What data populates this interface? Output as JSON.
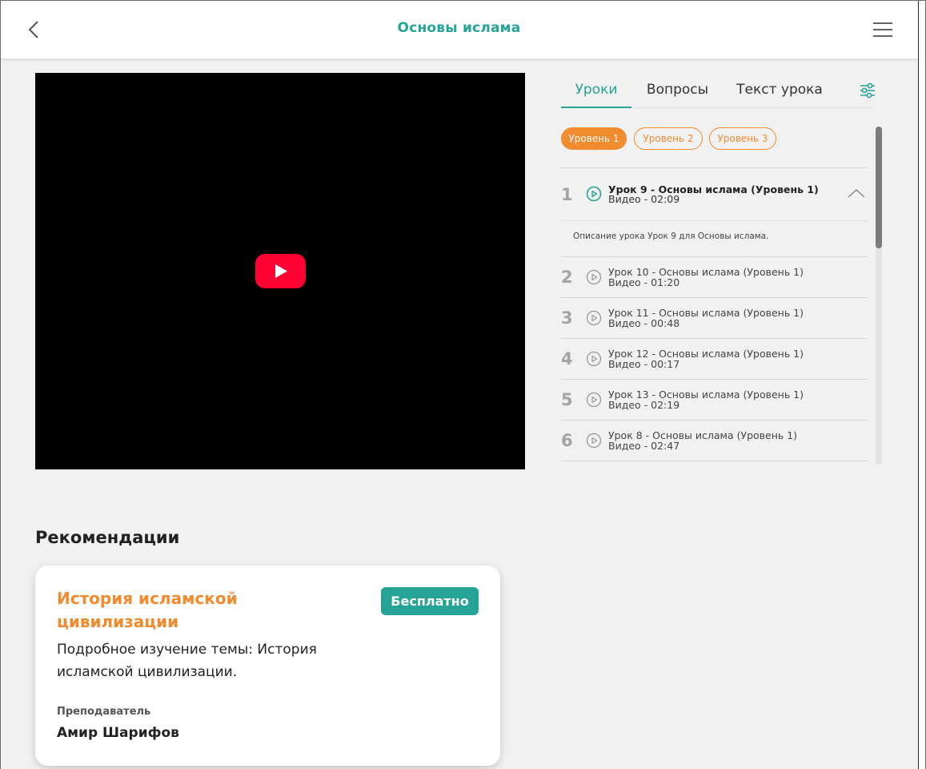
{
  "colors": {
    "accent": "#26a397",
    "orange": "#f28a2e",
    "youtube_red": "#ff0033"
  },
  "header": {
    "title": "Основы ислама",
    "back_icon": "chevron-left-icon",
    "menu_icon": "hamburger-menu-icon"
  },
  "video": {
    "play_icon": "youtube-play-icon"
  },
  "tabs": [
    {
      "label": "Уроки",
      "active": true
    },
    {
      "label": "Вопросы",
      "active": false
    },
    {
      "label": "Текст урока",
      "active": false
    }
  ],
  "filter_icon": "sliders-filter-icon",
  "levels": [
    {
      "label": "Уровень 1",
      "active": true
    },
    {
      "label": "Уровень 2",
      "active": false
    },
    {
      "label": "Уровень 3",
      "active": false
    }
  ],
  "lessons": [
    {
      "num": "1",
      "title": "Урок 9 - Основы ислама (Уровень 1)",
      "sub": "Видео - 02:09",
      "expanded": true,
      "description": "Описание урока Урок 9 для Основы ислама."
    },
    {
      "num": "2",
      "title": "Урок 10 - Основы ислама (Уровень 1)",
      "sub": "Видео - 01:20"
    },
    {
      "num": "3",
      "title": "Урок 11 - Основы ислама (Уровень 1)",
      "sub": "Видео - 00:48"
    },
    {
      "num": "4",
      "title": "Урок 12 - Основы ислама (Уровень 1)",
      "sub": "Видео - 00:17"
    },
    {
      "num": "5",
      "title": "Урок 13 - Основы ислама (Уровень 1)",
      "sub": "Видео - 02:19"
    },
    {
      "num": "6",
      "title": "Урок 8 - Основы ислама (Уровень 1)",
      "sub": "Видео - 02:47"
    }
  ],
  "recommendations": {
    "heading": "Рекомендации",
    "card": {
      "title": "История исламской цивилизации",
      "badge": "Бесплатно",
      "description": "Подробное изучение темы: История исламской цивилизации.",
      "teacher_label": "Преподаватель",
      "teacher_name": "Амир Шарифов"
    }
  }
}
